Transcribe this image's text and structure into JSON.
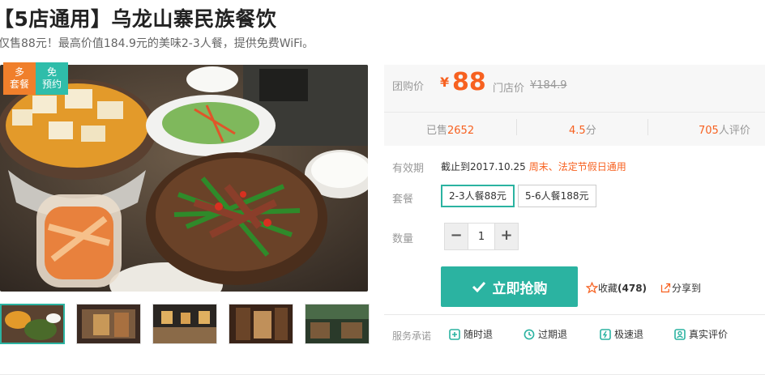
{
  "header": {
    "title": "【5店通用】乌龙山寨民族餐饮",
    "subtitle": "仅售88元！最高价值184.9元的美味2-3人餐，提供免费WiFi。"
  },
  "image_tags": {
    "tag1": "多\n套餐",
    "tag2": "免\n预约"
  },
  "price": {
    "label": "团购价",
    "currency": "¥",
    "value": "88",
    "store_label": "门店价",
    "store_price": "¥184.9"
  },
  "stats": {
    "sold_label": "已售",
    "sold": "2652",
    "rating": "4.5",
    "rating_unit": "分",
    "reviews": "705",
    "reviews_unit": "人评价"
  },
  "validity": {
    "label": "有效期",
    "value": "截止到2017.10.25",
    "note": "周末、法定节假日通用"
  },
  "package": {
    "label": "套餐",
    "options": [
      "2-3人餐88元",
      "5-6人餐188元"
    ]
  },
  "quantity": {
    "label": "数量",
    "minus": "−",
    "plus": "+",
    "value": "1"
  },
  "actions": {
    "buy": "立即抢购",
    "favorite_label": "收藏",
    "favorite_count": "(478)",
    "share": "分享到"
  },
  "promises": {
    "label": "服务承诺",
    "items": [
      "随时退",
      "过期退",
      "极速退",
      "真实评价"
    ]
  },
  "colors": {
    "accent": "#2bb3a1",
    "price": "#f76120",
    "tag_orange": "#f07f2b"
  }
}
